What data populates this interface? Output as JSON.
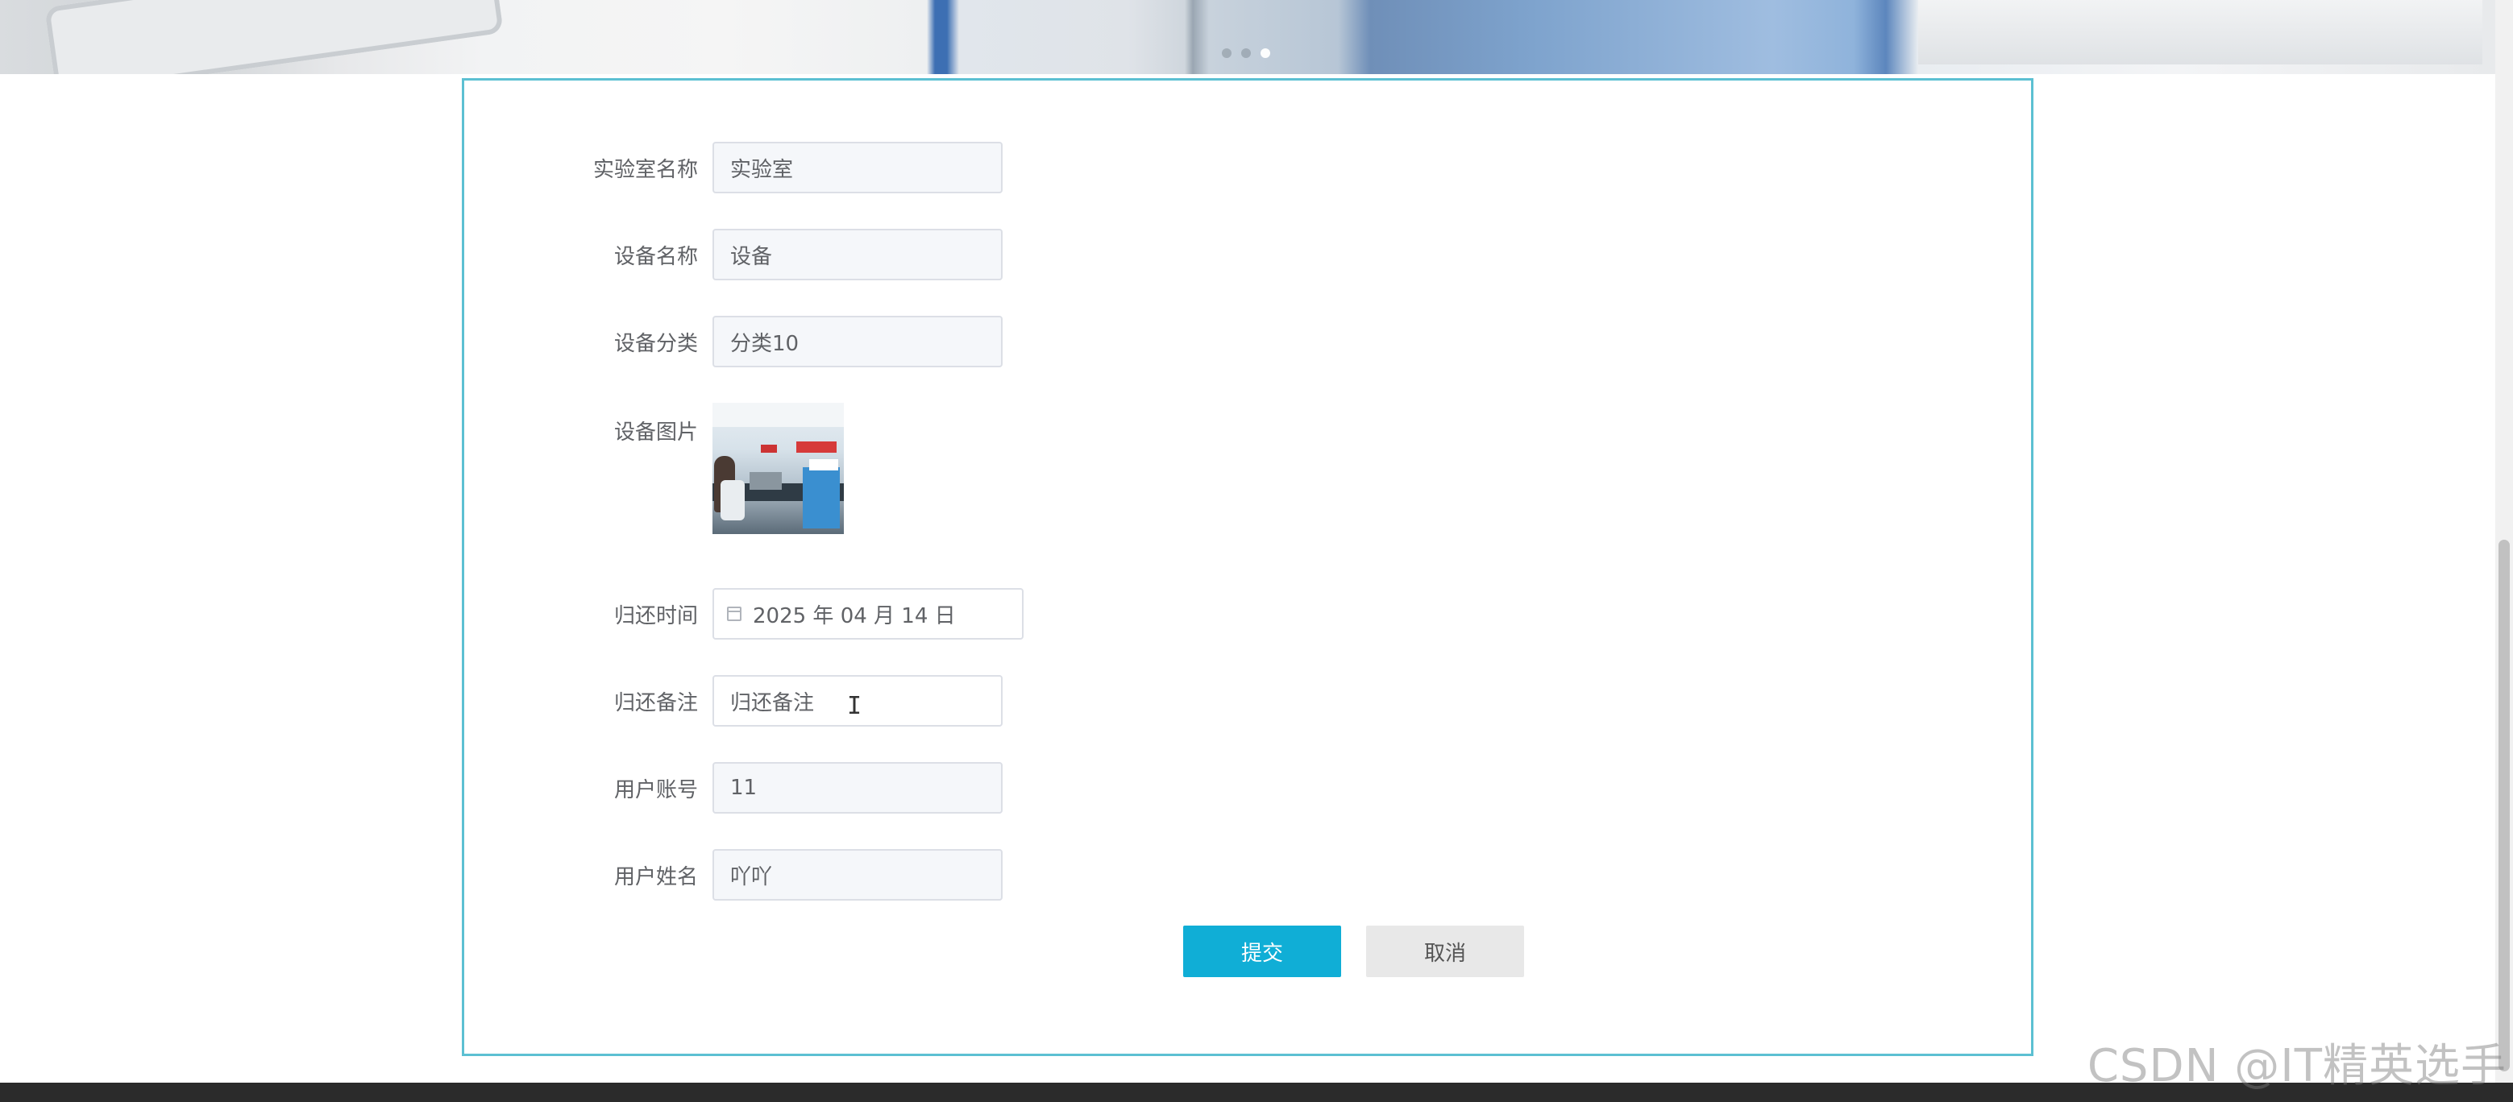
{
  "banner": {
    "slides": 3,
    "active_slide": 3
  },
  "form": {
    "lab_name": {
      "label": "实验室名称",
      "value": "实验室"
    },
    "device_name": {
      "label": "设备名称",
      "value": "设备"
    },
    "device_category": {
      "label": "设备分类",
      "value": "分类10"
    },
    "device_image": {
      "label": "设备图片"
    },
    "return_time": {
      "label": "归还时间",
      "value": "2025 年 04 月 14 日"
    },
    "return_note": {
      "label": "归还备注",
      "value": "归还备注"
    },
    "user_account": {
      "label": "用户账号",
      "value": "11"
    },
    "user_name": {
      "label": "用户姓名",
      "value": "吖吖"
    }
  },
  "buttons": {
    "submit": "提交",
    "cancel": "取消"
  },
  "watermark": "CSDN @IT精英选手",
  "colors": {
    "panel_border": "#5cc0d2",
    "submit_bg": "#10aed6",
    "cancel_bg": "#e8e8e8",
    "footer_bg": "#2b2b2b"
  }
}
